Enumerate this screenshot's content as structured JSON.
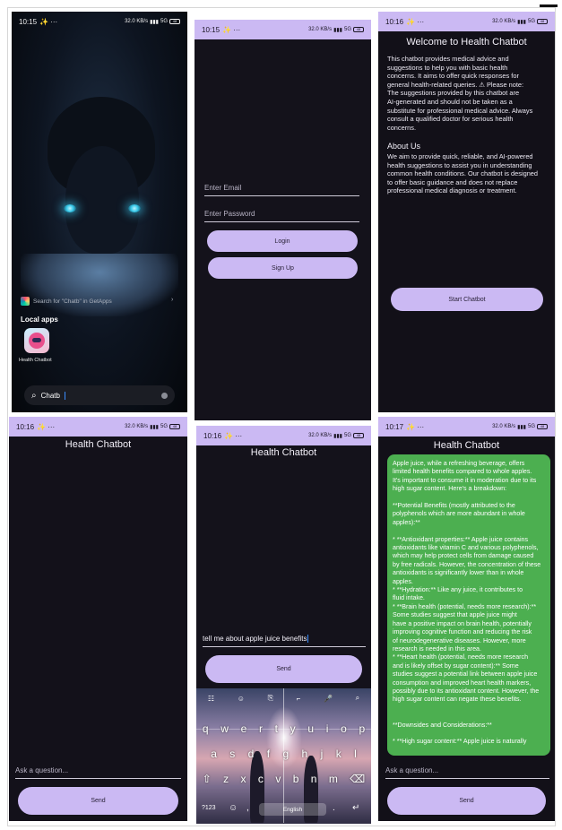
{
  "status_bars": {
    "p1_time": "10:15",
    "p2_time": "10:15",
    "p3_time": "10:16",
    "p4_time": "10:16",
    "p5_time": "10:16",
    "p6_time": "10:17",
    "left_glyphs": "✨ ···",
    "net_speed": "32.0 KB/s",
    "signal": "5G",
    "battery": "48"
  },
  "phone1": {
    "get_apps_text": "Search for \"Chatb\" in GetApps",
    "local_apps": "Local apps",
    "app_name": "Health Chatbot",
    "search_value": "Chatb"
  },
  "phone2": {
    "email_placeholder": "Enter Email",
    "password_placeholder": "Enter Password",
    "login_label": "Login",
    "signup_label": "Sign Up"
  },
  "phone3": {
    "title": "Welcome to Health Chatbot",
    "intro_lines": [
      "This chatbot provides medical advice and",
      "suggestions to help you with basic health",
      "concerns. It aims to offer quick responses for",
      "general health-related queries.  ⚠ Please note:",
      "The suggestions provided by this chatbot are",
      "AI-generated and should not be taken as a",
      "substitute for professional medical advice. Always",
      "consult a qualified doctor for serious health",
      "concerns."
    ],
    "about_heading": "About Us",
    "about_lines": [
      "We aim to provide quick, reliable, and AI-powered",
      "health suggestions to assist you in understanding",
      "common health conditions. Our chatbot is designed",
      "to offer basic guidance and does not replace",
      "professional medical diagnosis or treatment."
    ],
    "start_label": "Start Chatbot"
  },
  "phone4": {
    "title": "Health Chatbot",
    "placeholder": "Ask a question...",
    "send_label": "Send"
  },
  "phone5": {
    "title": "Health Chatbot",
    "input_value": "tell me about apple juice benefits",
    "send_label": "Send",
    "keyboard": {
      "row1": [
        "q",
        "w",
        "e",
        "r",
        "t",
        "y",
        "u",
        "i",
        "o",
        "p"
      ],
      "row2": [
        "a",
        "s",
        "d",
        "f",
        "g",
        "h",
        "j",
        "k",
        "l"
      ],
      "row3": [
        "⇧",
        "z",
        "x",
        "c",
        "v",
        "b",
        "n",
        "m",
        "⌫"
      ],
      "symbols_key": "?123",
      "emoji_key": "☺",
      "comma_key": ",",
      "space_label": "English",
      "period_key": ".",
      "enter_key": "↵",
      "top_icons": [
        "☷",
        "☺",
        "⎘",
        "⌐",
        "🎤",
        "⌕"
      ]
    }
  },
  "phone6": {
    "title": "Health Chatbot",
    "response_lines": [
      "Apple juice, while a refreshing beverage, offers",
      "limited health benefits compared to whole apples.",
      "It's important to consume it in moderation due to its",
      "high sugar content.  Here's a breakdown:",
      "",
      "**Potential Benefits (mostly attributed to the",
      "polyphenols which are more abundant in whole",
      "apples):**",
      "",
      "* **Antioxidant properties:** Apple juice contains",
      "antioxidants like vitamin C and various polyphenols,",
      "which may help protect cells from damage caused",
      "by free radicals. However, the concentration of these",
      "antioxidants is significantly lower than in whole",
      "apples.",
      "* **Hydration:**  Like any juice, it contributes to",
      "fluid intake.",
      "* **Brain health (potential, needs more research):**",
      "Some studies suggest that apple juice might",
      "have a positive impact on brain health, potentially",
      "improving cognitive function and reducing the risk",
      "of neurodegenerative diseases.  However, more",
      "research is needed in this area.",
      "* **Heart health (potential, needs more research",
      "and is likely offset by sugar content):**  Some",
      "studies suggest a potential link between apple juice",
      "consumption and improved heart health markers,",
      "possibly due to its antioxidant content. However, the",
      "high sugar content can negate these benefits.",
      "",
      "",
      "**Downsides and Considerations:**",
      "",
      "* **High sugar content:** Apple juice is naturally"
    ],
    "placeholder": "Ask a question...",
    "send_label": "Send"
  },
  "colors": {
    "accent": "#cbb9f3",
    "background": "#13111a",
    "response_bubble": "#4caf50"
  }
}
